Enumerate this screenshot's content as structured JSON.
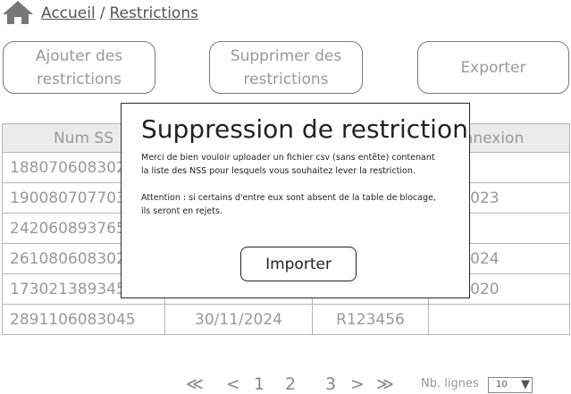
{
  "breadcrumb": {
    "home": "Accueil",
    "separator": "/",
    "current": "Restrictions"
  },
  "toolbar": {
    "add_line1": "Ajouter des",
    "add_line2": "restrictions",
    "delete_line1": "Supprimer des",
    "delete_line2": "restrictions",
    "export": "Exporter"
  },
  "table": {
    "headers": [
      "Num SS",
      "",
      "",
      ". connexion"
    ],
    "rows": [
      [
        "188070608302",
        "",
        "",
        ""
      ],
      [
        "190080707703",
        "",
        "",
        "10/2023"
      ],
      [
        "242060893765",
        "",
        "",
        ""
      ],
      [
        "261080608302",
        "",
        "",
        "11/2024"
      ],
      [
        "173021389345",
        "",
        "",
        "07/2020"
      ],
      [
        "2891106083045",
        "30/11/2024",
        "R123456",
        ""
      ]
    ]
  },
  "modal": {
    "title": "Suppression de restriction",
    "paragraph1": "Merci de bien vouloir uploader un fichier csv (sans entête) contenant la liste des NSS pour lesquels vous souhaitez lever la restriction.",
    "paragraph2": "Attention : si certains d'entre eux sont absent de la table de blocage, ils seront en rejets.",
    "import_label": "Importer"
  },
  "pagination": {
    "first": "≪",
    "prev": "<",
    "page1": "1",
    "page2": "2",
    "page3": "3",
    "next": ">",
    "last": "≫",
    "rows_label": "Nb. lignes",
    "rows_value": "10",
    "rows_arrow": "▼"
  },
  "icons": {
    "home": "home-icon"
  },
  "colors": {
    "header_bg": "#ebebeb",
    "border": "#b5b5b5",
    "modal_border": "#2a2a2a"
  }
}
